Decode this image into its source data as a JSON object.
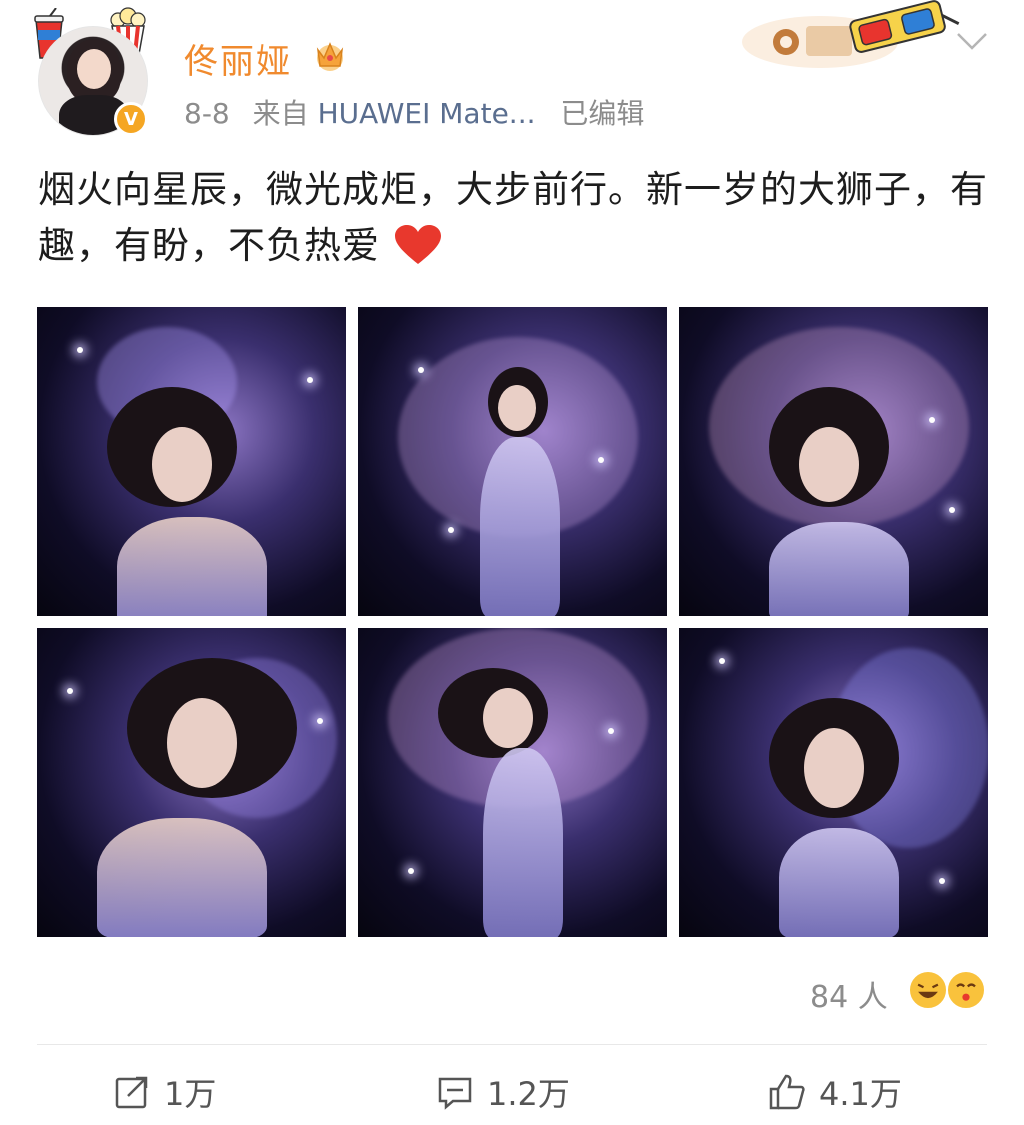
{
  "post": {
    "author": "佟丽娅",
    "date": "8-8",
    "source_prefix": "来自",
    "source": "HUAWEI Mate...",
    "edited": "已编辑",
    "text": "烟火向星辰，微光成炬，大步前行。新一岁的大狮子，有趣，有盼，不负热爱",
    "photos": [
      {
        "label": "photo-1"
      },
      {
        "label": "photo-2"
      },
      {
        "label": "photo-3"
      },
      {
        "label": "photo-4"
      },
      {
        "label": "photo-5"
      },
      {
        "label": "photo-6"
      }
    ]
  },
  "reactions": {
    "count": "84 人"
  },
  "actions": {
    "repost": "1万",
    "comment": "1.2万",
    "like": "4.1万"
  },
  "colors": {
    "name": "#f08a2e",
    "meta": "#8c8c8c",
    "source": "#5a6e8f",
    "verified": "#f5a623"
  },
  "icons": {
    "verified": "verified-v-icon",
    "crown": "crown-icon",
    "chevron": "chevron-down-icon",
    "repost": "repost-icon",
    "comment": "comment-icon",
    "like": "thumbs-up-icon",
    "heart": "red-heart-icon"
  }
}
